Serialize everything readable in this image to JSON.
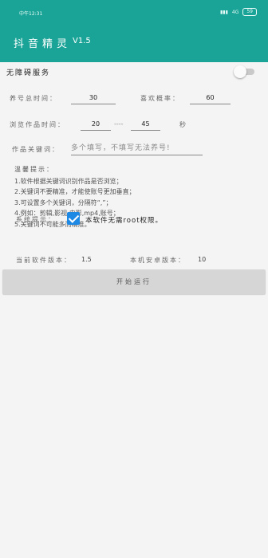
{
  "status_bar": {
    "time": "中午12:31",
    "network": "4G",
    "battery": "59"
  },
  "app_bar": {
    "title": "抖音精灵",
    "version": "V1.5"
  },
  "accessibility": {
    "label": "无障碍服务",
    "enabled": false
  },
  "settings": {
    "switch_time_label": "养号总时间：",
    "switch_time_value": "30",
    "like_rate_label": "喜欢概率：",
    "like_rate_value": "60",
    "browse_time_label": "浏览作品时间：",
    "browse_min": "20",
    "browse_sep": "----",
    "browse_max": "45",
    "browse_unit": "秒",
    "keyword_label": "作品关键词：",
    "keyword_placeholder": "多个填写，不填写无法养号!"
  },
  "tips": {
    "heading": "温馨提示：",
    "lines": [
      "1.软件根据关键词识别作品是否浏览；",
      "2.关键词不要精准，才能使账号更加垂直；",
      "3.可设置多个关键词，分隔符“,”；",
      "4.例如：剪辑,影视,电影,mp4,账号；",
      "5.关键词不可能多而精准。"
    ]
  },
  "system_tip": {
    "label": "系统提示：",
    "checked": true,
    "text": "本软件无需root权限。"
  },
  "versions": {
    "current_label": "当前软件版本：",
    "current_value": "1.5",
    "android_label": "本机安卓版本：",
    "android_value": "10"
  },
  "start_button": "开始运行",
  "colors": {
    "primary": "#1aa497",
    "checkbox": "#1e88e5"
  }
}
